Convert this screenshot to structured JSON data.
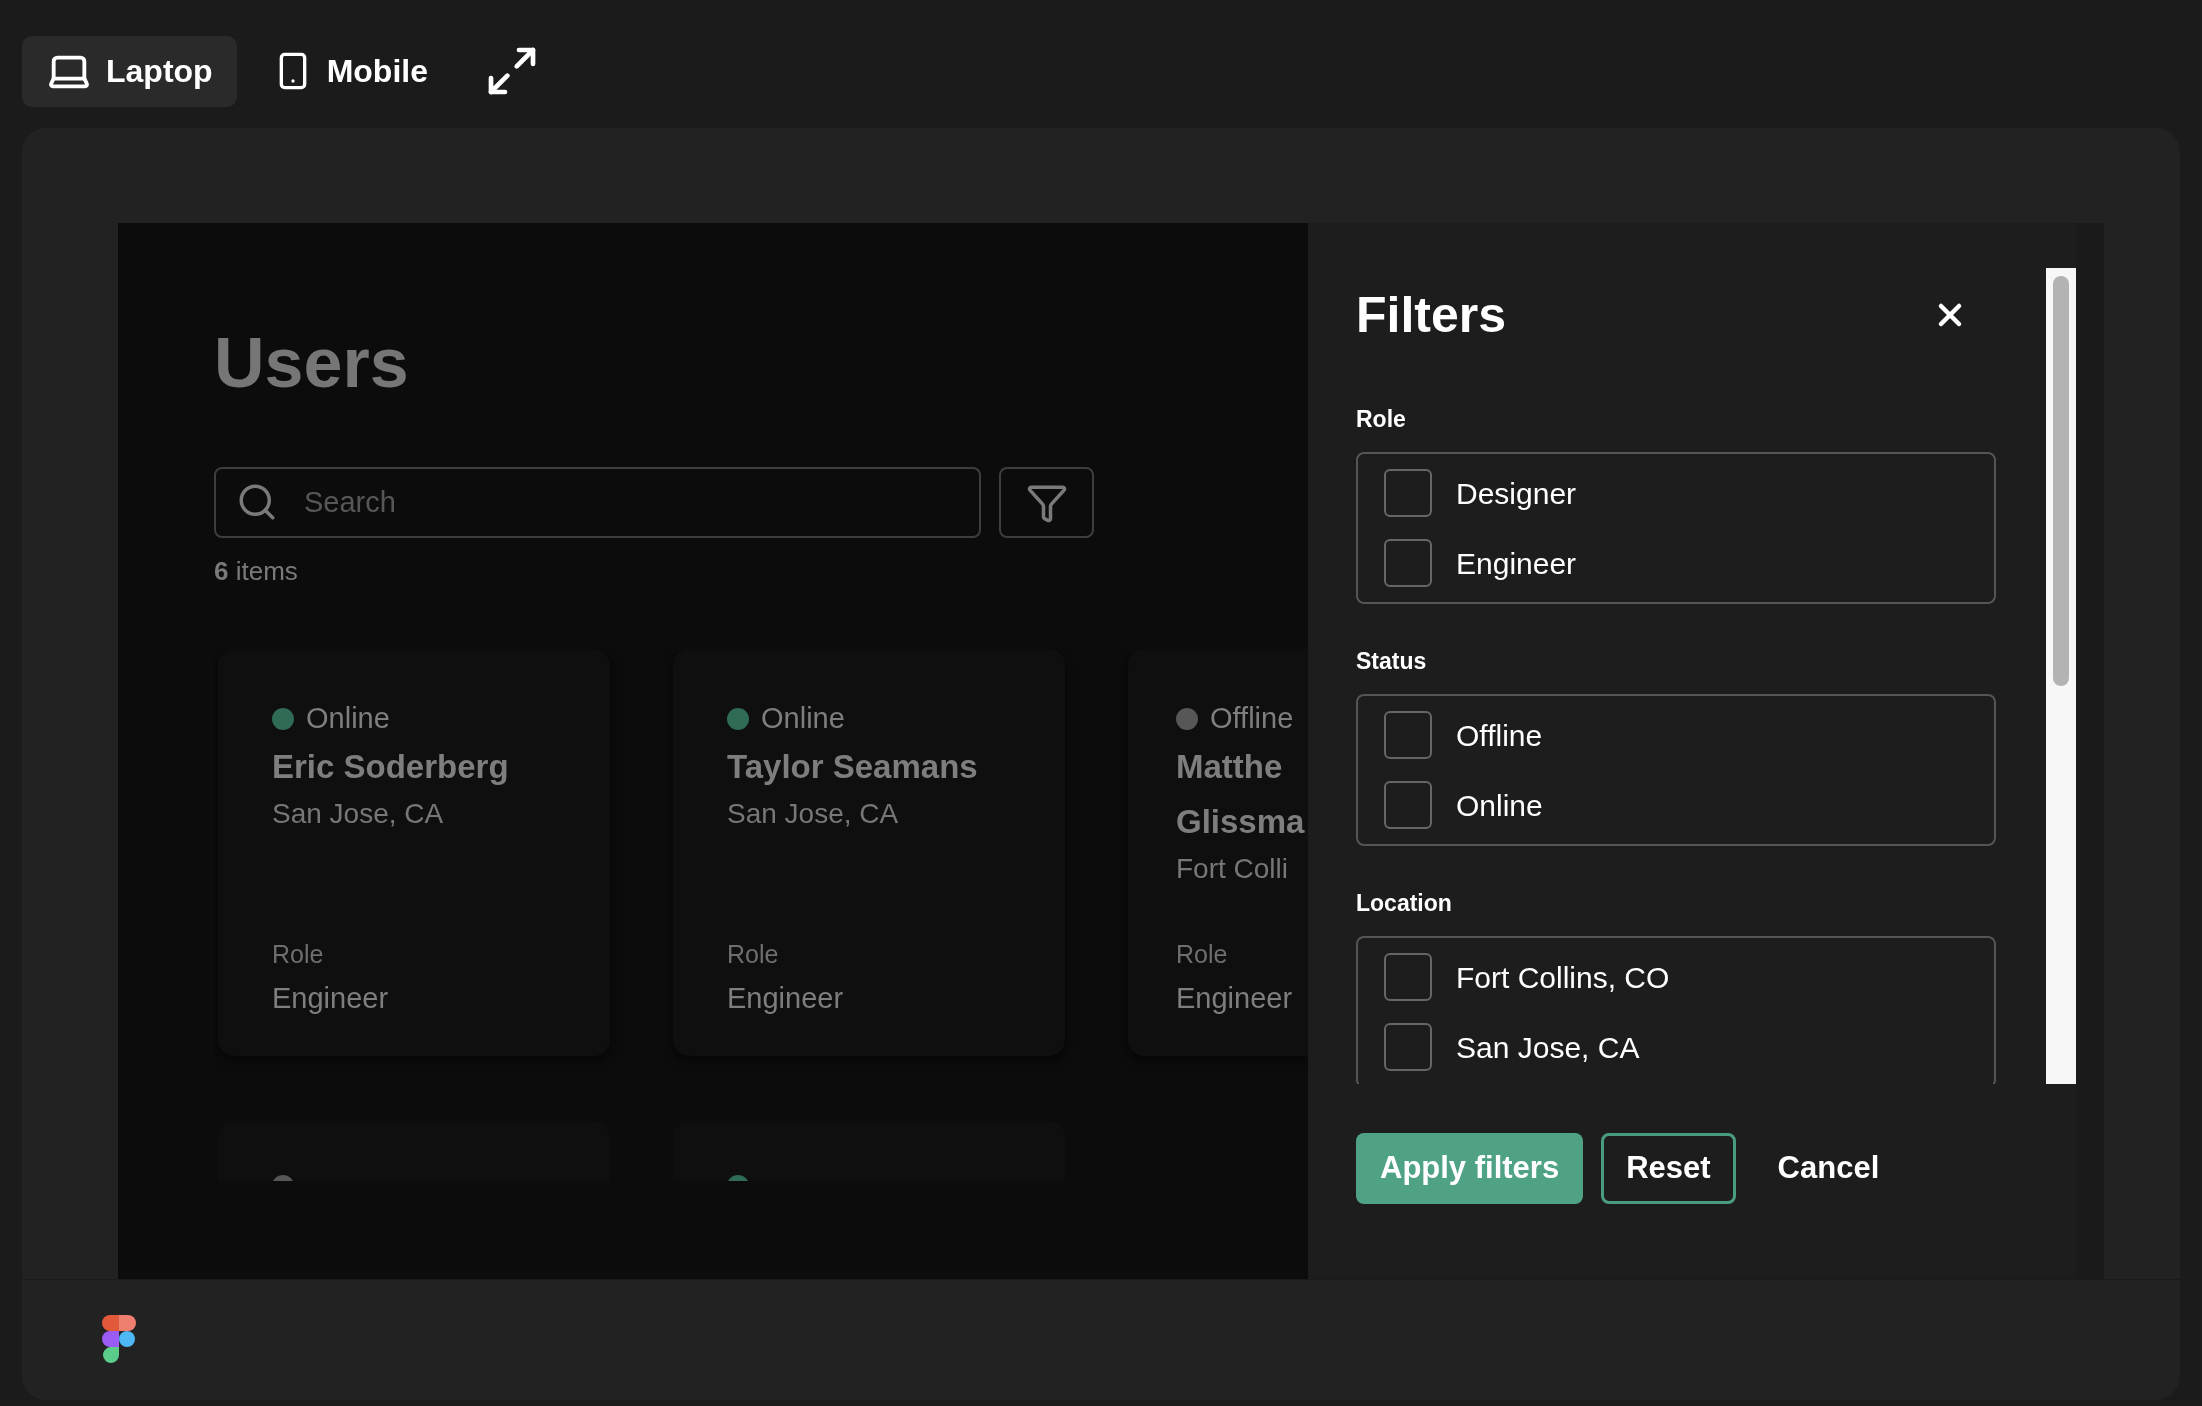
{
  "device_tabs": [
    {
      "label": "Laptop",
      "kind": "laptop",
      "selected": true
    },
    {
      "label": "Mobile",
      "kind": "mobile",
      "selected": false
    }
  ],
  "page": {
    "title": "Users",
    "search": {
      "placeholder": "Search"
    },
    "item_count": "**6** items",
    "cards": [
      {
        "status": "Online",
        "color": "#2f6b55",
        "name": "Eric Soderberg",
        "location": "San Jose, CA",
        "role_label": "Role",
        "role": "Engineer"
      },
      {
        "status": "Online",
        "color": "#2f6b55",
        "name": "Taylor Seamans",
        "location": "San Jose, CA",
        "role_label": "Role",
        "role": "Engineer"
      },
      {
        "status": "Offline",
        "color": "#575757",
        "name": "Matthe Glissma",
        "location": "Fort Colli",
        "role_label": "Role",
        "role": "Engineer"
      }
    ],
    "partial_cards": [
      {
        "color": "#575757"
      },
      {
        "color": "#2f6b55"
      }
    ]
  },
  "filters": {
    "title": "Filters",
    "groups": [
      {
        "label": "Role",
        "options": [
          {
            "label": "Designer",
            "checked": false
          },
          {
            "label": "Engineer",
            "checked": false
          }
        ]
      },
      {
        "label": "Status",
        "options": [
          {
            "label": "Offline",
            "checked": false
          },
          {
            "label": "Online",
            "checked": false
          }
        ]
      },
      {
        "label": "Location",
        "options": [
          {
            "label": "Fort Collins, CO",
            "checked": false
          },
          {
            "label": "San Jose, CA",
            "checked": false
          }
        ]
      }
    ],
    "buttons": [
      {
        "label": "Apply filters",
        "kind": "primary"
      },
      {
        "label": "Reset",
        "kind": "secondary"
      },
      {
        "label": "Cancel",
        "kind": "plain"
      }
    ]
  }
}
